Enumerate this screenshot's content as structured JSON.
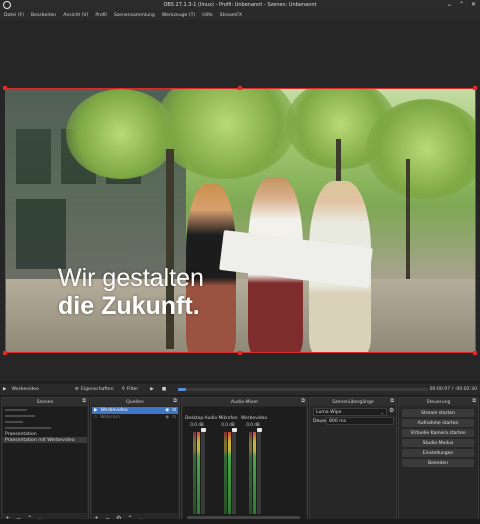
{
  "window": {
    "title": "OBS 27.1.3-1 (linux) - Profil: Unbenannt - Szenen: Unbenannt"
  },
  "menu": [
    "Datei (F)",
    "Bearbeiten",
    "Ansicht (V)",
    "Profil",
    "Szenensammlung",
    "Werkzeuge (T)",
    "Hilfe",
    "StreamFX"
  ],
  "preview": {
    "tagline_line1": "Wir gestalten",
    "tagline_line2": "die Zukunft."
  },
  "transport": {
    "source_name": "Werbevideo",
    "properties_label": "Eigenschaften",
    "filter_label": "Filter",
    "progress": 0.03,
    "elapsed": "00:00:07",
    "remaining": "-00:02:30"
  },
  "scenes": {
    "title": "Szenen",
    "items": [
      {
        "label": "",
        "blurred": true
      },
      {
        "label": "",
        "blurred": true
      },
      {
        "label": "",
        "blurred": true
      },
      {
        "label": "",
        "blurred": true
      },
      {
        "label": "Praesentation",
        "blurred": false
      },
      {
        "label": "Praesentation mit Werbevideo",
        "blurred": false,
        "selected": true
      }
    ]
  },
  "sources": {
    "title": "Quellen",
    "items": [
      {
        "label": "Werbevideo",
        "selected": true
      },
      {
        "label": "Webcam",
        "disabled": true
      }
    ]
  },
  "mixer": {
    "title": "Audio-Mixer",
    "channels": [
      {
        "name": "Desktop-Audio",
        "db": "0.0 dB"
      },
      {
        "name": "Mikrofon",
        "db": "0.0 dB"
      },
      {
        "name": "Werbevideo",
        "db": "0.0 dB"
      }
    ]
  },
  "transitions": {
    "title": "Szenenübergänge",
    "type": "Luma Wipe",
    "duration_label": "Dauer",
    "duration_value": "800 ms"
  },
  "controls": {
    "title": "Steuerung",
    "buttons": [
      "Stream starten",
      "Aufnahme starten",
      "Virtuelle Kamera starten",
      "Studio-Modus",
      "Einstellungen",
      "Beenden"
    ]
  },
  "colors": {
    "accent": "#3f77c6",
    "preview_border": "#d92b2b"
  }
}
